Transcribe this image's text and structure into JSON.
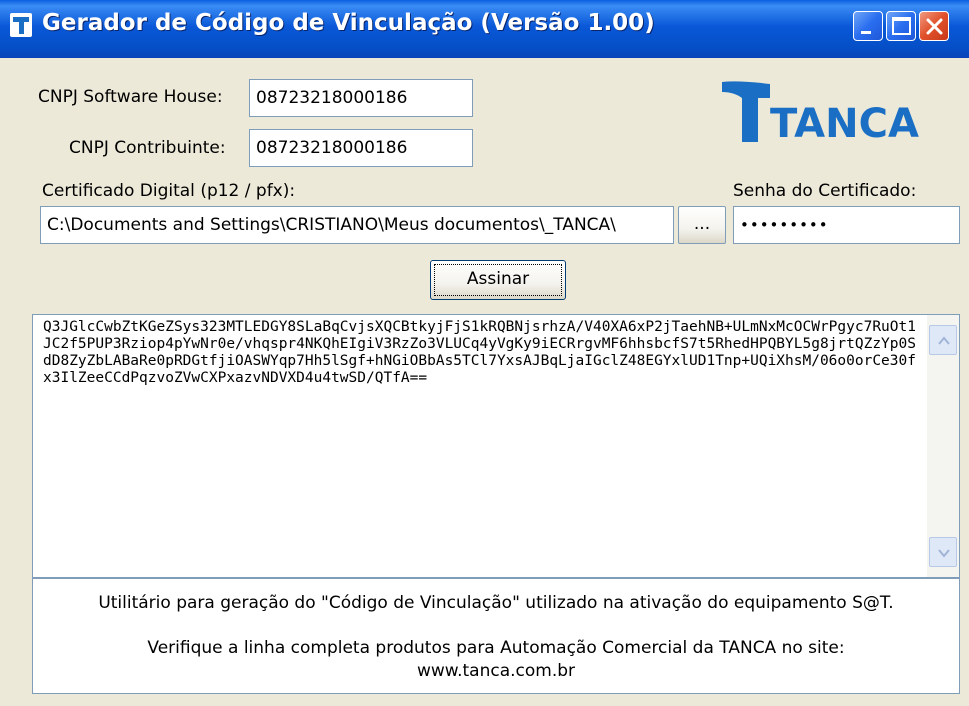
{
  "window": {
    "title": "Gerador de Código de Vinculação (Versão 1.00)",
    "controls": {
      "minimize": "minimize-icon",
      "maximize": "maximize-icon",
      "close": "close-icon"
    }
  },
  "form": {
    "cnpj_sh_label": "CNPJ Software House:",
    "cnpj_sh_value": "08723218000186",
    "cnpj_contrib_label": "CNPJ Contribuinte:",
    "cnpj_contrib_value": "08723218000186",
    "cert_label": "Certificado Digital (p12 / pfx):",
    "cert_path": "C:\\Documents and Settings\\CRISTIANO\\Meus documentos\\_TANCA\\",
    "browse_label": "...",
    "senha_label": "Senha do Certificado:",
    "senha_value": "•••••••••",
    "sign_label": "Assinar"
  },
  "logo": {
    "text": "TANCA",
    "color": "#1a6fc4"
  },
  "output": {
    "text": "Q3JGlcCwbZtKGeZSys323MTLEDGY8SLaBqCvjsXQCBtkyjFjS1kRQBNjsrhzA/V40XA6xP2jTaehNB+ULmNxMcOCWrPgyc7RuOt1JC2f5PUP3Rziop4pYwNr0e/vhqspr4NKQhEIgiV3RzZo3VLUCq4yVgKy9iECRrgvMF6hhsbcfS7t5RhedHPQBYL5g8jrtQZzYp0SdD8ZyZbLABaRe0pRDGtfjiOASWYqp7Hh5lSgf+hNGiOBbAs5TCl7YxsAJBqLjaIGclZ48EGYxlUD1Tnp+UQiXhsM/06o0orCe30fx3IlZeeCCdPqzvoZVwCXPxazvNDVXD4u4twSD/QTfA=="
  },
  "info": {
    "line1": "Utilitário para geração do \"Código de Vinculação\" utilizado na ativação do equipamento S@T.",
    "line2": "Verifique a linha completa produtos para Automação Comercial da TANCA no site:",
    "line3": "www.tanca.com.br"
  }
}
